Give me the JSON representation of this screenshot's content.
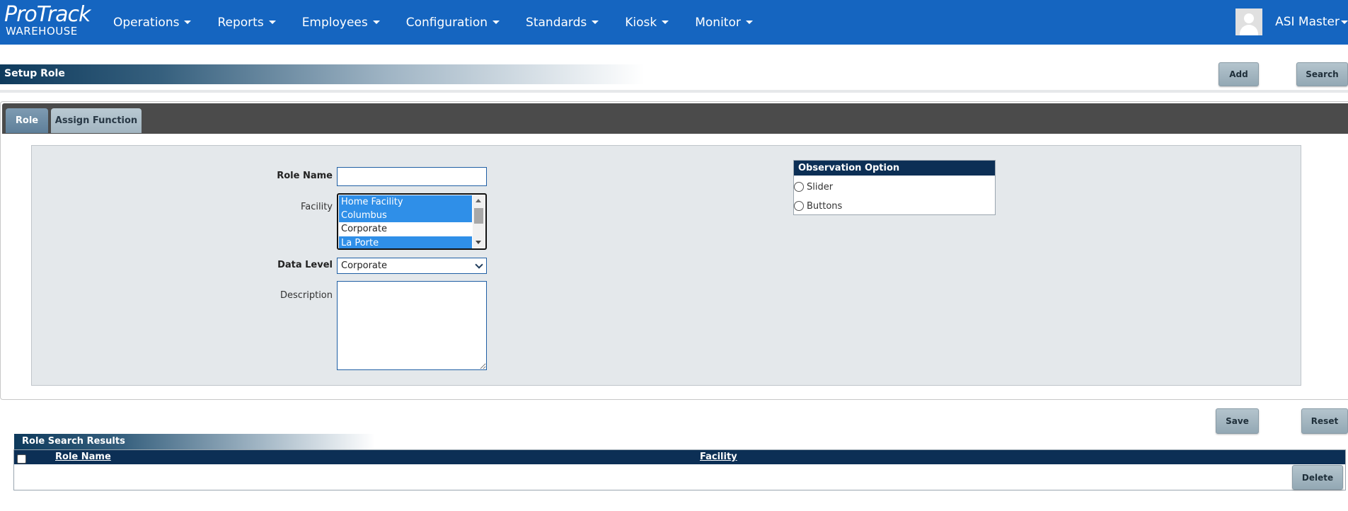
{
  "brand": {
    "logo_main": "ProTrack",
    "logo_sub": "WAREHOUSE"
  },
  "nav": {
    "items": [
      {
        "label": "Operations"
      },
      {
        "label": "Reports"
      },
      {
        "label": "Employees"
      },
      {
        "label": "Configuration"
      },
      {
        "label": "Standards"
      },
      {
        "label": "Kiosk"
      },
      {
        "label": "Monitor"
      }
    ],
    "user": {
      "name": "ASI Master",
      "avatar_icon": "user-avatar-icon"
    }
  },
  "page": {
    "title": "Setup Role",
    "add_label": "Add",
    "search_label": "Search"
  },
  "tabs": [
    {
      "label": "Role",
      "active": true
    },
    {
      "label": "Assign Function",
      "active": false
    }
  ],
  "form": {
    "role_name_label": "Role Name",
    "role_name_value": "",
    "facility_label": "Facility",
    "facility_options": [
      {
        "label": "Home Facility",
        "selected": true
      },
      {
        "label": "Columbus",
        "selected": true
      },
      {
        "label": "Corporate",
        "selected": false
      },
      {
        "label": "La Porte",
        "selected": true
      }
    ],
    "data_level_label": "Data Level",
    "data_level_value": "Corporate",
    "description_label": "Description",
    "description_value": ""
  },
  "observation": {
    "title": "Observation Option",
    "options": [
      {
        "label": "Slider",
        "checked": false
      },
      {
        "label": "Buttons",
        "checked": false
      }
    ]
  },
  "actions": {
    "save_label": "Save",
    "reset_label": "Reset"
  },
  "results": {
    "title": "Role Search Results",
    "columns": [
      "Role Name",
      "Facility"
    ],
    "rows": [],
    "delete_label": "Delete"
  },
  "colors": {
    "nav_bg": "#1565c0",
    "header_dark": "#0c2f55",
    "selection": "#2f8fe8",
    "tab_strip": "#4b4b4b",
    "form_bg": "#e4e8eb"
  }
}
